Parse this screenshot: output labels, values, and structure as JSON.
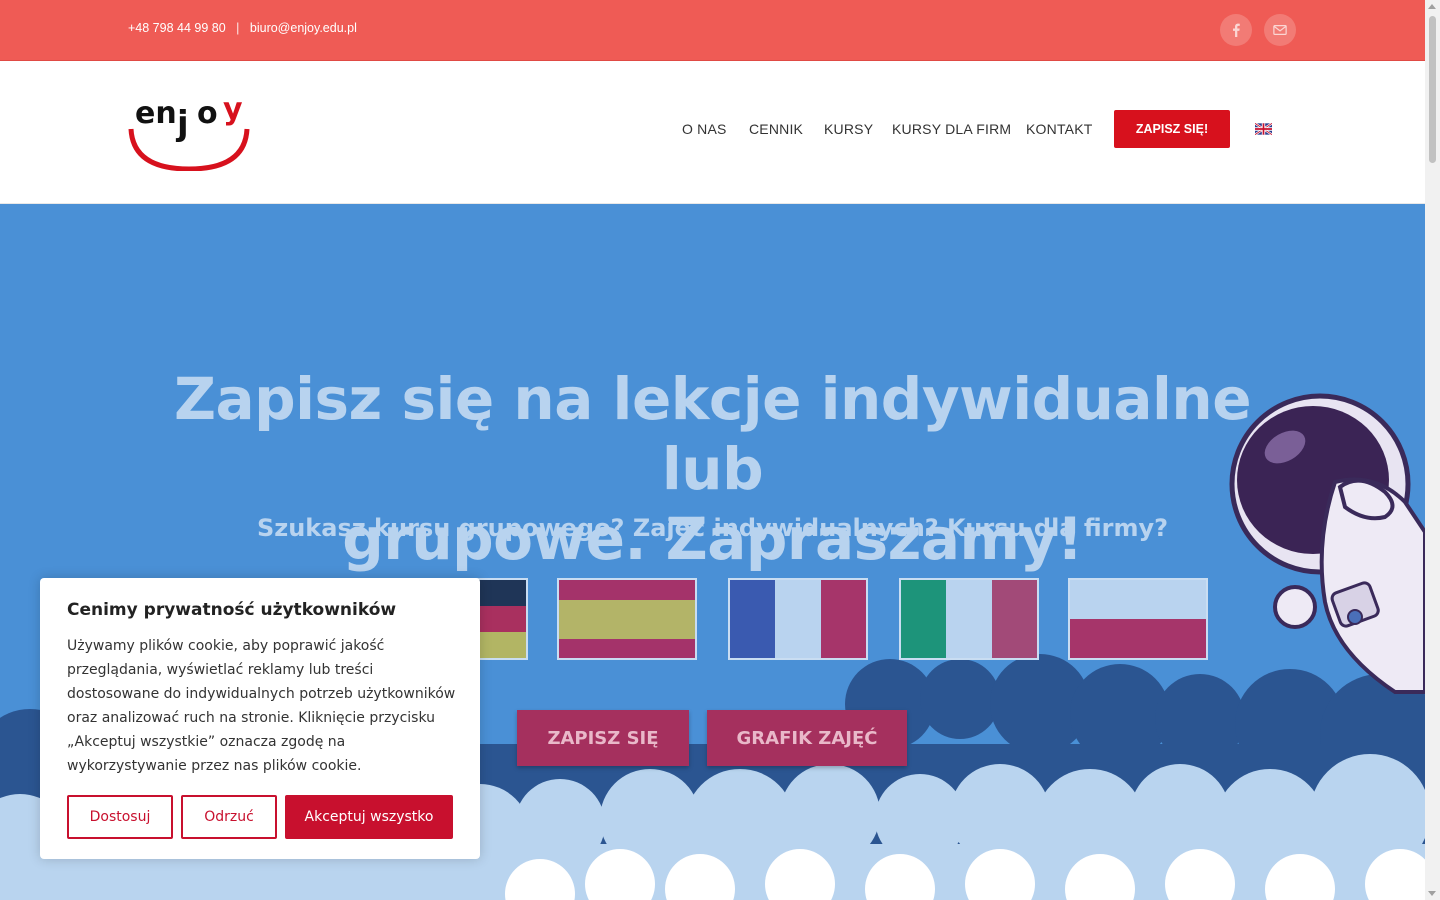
{
  "topbar": {
    "phone": "+48 798 44 99 80",
    "separator": "|",
    "email": "biuro@enjoy.edu.pl",
    "icons": [
      "facebook-icon",
      "mail-icon"
    ]
  },
  "header": {
    "logo_text": "enjoy",
    "nav": [
      "O NAS",
      "CENNIK",
      "KURSY",
      "KURSY DLA FIRM",
      "KONTAKT"
    ],
    "cta": "ZAPISZ SIĘ!",
    "language_icon": "uk-flag-icon"
  },
  "hero": {
    "title_line1": "Zapisz się na lekcje indywidualne lub",
    "title_line2": "grupowe. Zapraszamy!",
    "subtitle": "Szukasz kursu grupowego? Zajęć indywidualnych? Kursu dla firmy?",
    "flags": [
      "germany-flag",
      "spain-flag",
      "france-flag",
      "italy-flag",
      "poland-flag"
    ],
    "buttons": [
      "ZAPISZ SIĘ",
      "GRAFIK ZAJĘĆ"
    ]
  },
  "cookie": {
    "title": "Cenimy prywatność użytkowników",
    "text": "Używamy plików cookie, aby poprawić jakość przeglądania, wyświetlać reklamy lub treści dostosowane do indywidualnych potrzeb użytkowników oraz analizować ruch na stronie. Kliknięcie przycisku „Akceptuj wszystkie” oznacza zgodę na wykorzystywanie przez nas plików cookie.",
    "customize": "Dostosuj",
    "reject": "Odrzuć",
    "accept": "Akceptuj wszystko"
  },
  "colors": {
    "topbar": "#ef5b55",
    "brand_red": "#d7111d",
    "hero_bg": "#4a90d6",
    "hero_text": "#b8d3ef"
  }
}
